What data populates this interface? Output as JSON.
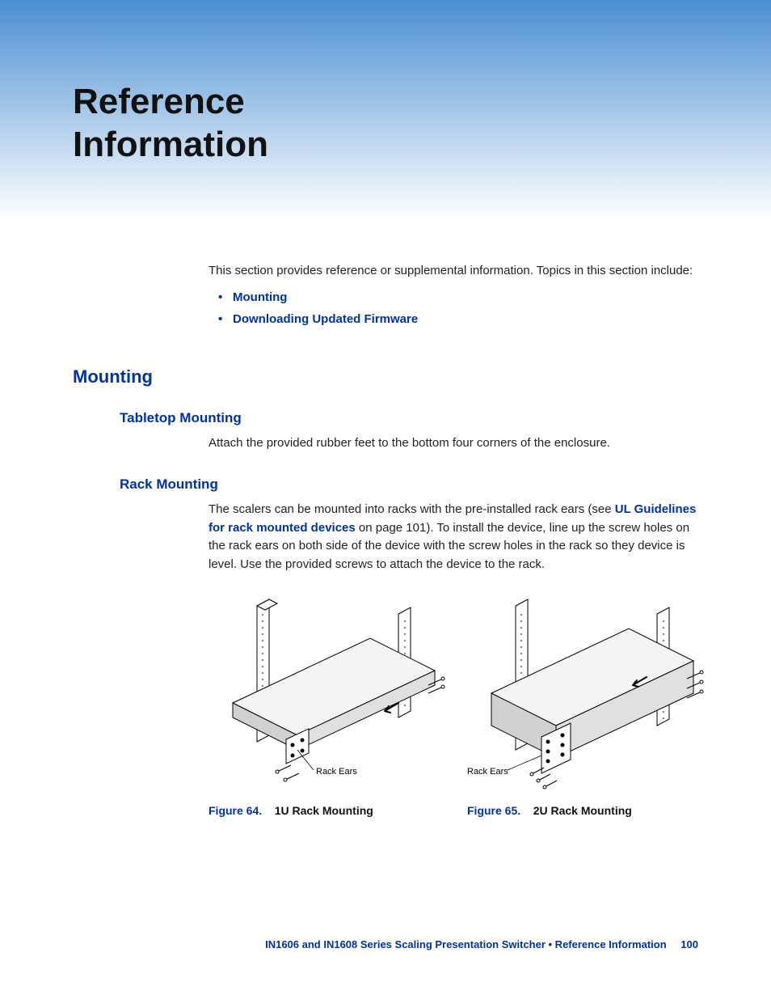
{
  "title_line1": "Reference",
  "title_line2": "Information",
  "intro": "This section provides reference or supplemental information. Topics in this section include:",
  "toc": {
    "item1": "Mounting",
    "item2": "Downloading Updated Firmware"
  },
  "mounting": {
    "heading": "Mounting",
    "tabletop": {
      "heading": "Tabletop Mounting",
      "text": "Attach the provided rubber feet to the bottom four corners of the enclosure."
    },
    "rack": {
      "heading": "Rack Mounting",
      "text_pre": "The scalers can be mounted into racks with the pre-installed rack ears (see ",
      "link": "UL Guidelines for rack mounted devices",
      "text_post": " on page 101). To install the device, line up the screw holes on the rack ears on both side of the device with the screw holes in the rack so they device is level. Use the provided screws to attach the device to the rack.",
      "fig1_label": "Rack Ears",
      "fig2_label": "Rack Ears",
      "fig1_num": "Figure 64.",
      "fig1_title": "1U Rack Mounting",
      "fig2_num": "Figure 65.",
      "fig2_title": "2U Rack Mounting"
    }
  },
  "footer": {
    "text": "IN1606 and IN1608 Series Scaling Presentation Switcher • Reference Information",
    "page": "100"
  }
}
